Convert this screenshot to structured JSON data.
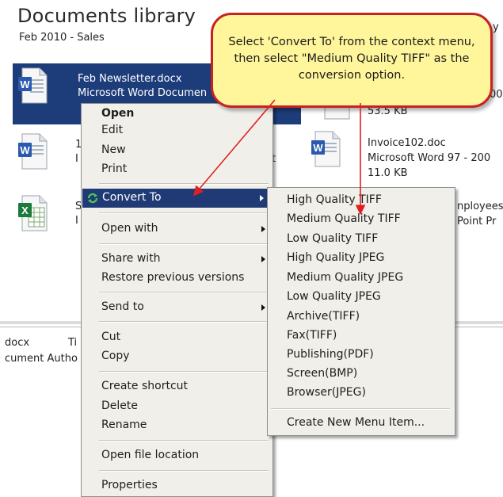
{
  "library": {
    "title": "Documents library",
    "subtitle": "Feb 2010 - Sales"
  },
  "files": {
    "selected": {
      "name": "Feb Newsletter.docx",
      "type": "Microsoft Word Documen"
    },
    "word_doc_partial": {
      "name": "1",
      "type": "I",
      "tail": "t"
    },
    "excel_partial": {
      "name": "S",
      "type": "I"
    },
    "top_right_size": "53.5 KB",
    "top_right_partial_a": "y",
    "top_right_partial_b": "00",
    "invoice": {
      "name": "Invoice102.doc",
      "type": "Microsoft Word 97 - 200",
      "size": "11.0 KB"
    },
    "employees": {
      "name": "nployees",
      "type": "Point Pr"
    }
  },
  "details": {
    "col1": "docx",
    "col2": "Ti",
    "row2": "cument Autho"
  },
  "context_menu": {
    "open": "Open",
    "edit": "Edit",
    "new": "New",
    "print": "Print",
    "convert_to": "Convert To",
    "open_with": "Open with",
    "share_with": "Share with",
    "restore": "Restore previous versions",
    "send_to": "Send to",
    "cut": "Cut",
    "copy": "Copy",
    "create_shortcut": "Create shortcut",
    "delete": "Delete",
    "rename": "Rename",
    "open_file_location": "Open file location",
    "properties": "Properties"
  },
  "submenu": {
    "items": [
      "High Quality TIFF",
      "Medium Quality TIFF",
      "Low Quality TIFF",
      "High Quality JPEG",
      "Medium Quality JPEG",
      "Low Quality JPEG",
      "Archive(TIFF)",
      "Fax(TIFF)",
      "Publishing(PDF)",
      "Screen(BMP)",
      "Browser(JPEG)"
    ],
    "create_new": "Create New Menu Item..."
  },
  "callout": {
    "text": "Select 'Convert To' from the context menu, then select \"Medium Quality TIFF\" as the conversion option."
  },
  "colors": {
    "selection": "#1d3d7a",
    "menu_highlight": "#1f3a75",
    "callout_fill": "#fff59a",
    "callout_border": "#c82121",
    "arrow": "#e02020"
  },
  "icons": {
    "word": "word-document-icon",
    "excel": "excel-document-icon",
    "convert": "convert-refresh-icon"
  }
}
